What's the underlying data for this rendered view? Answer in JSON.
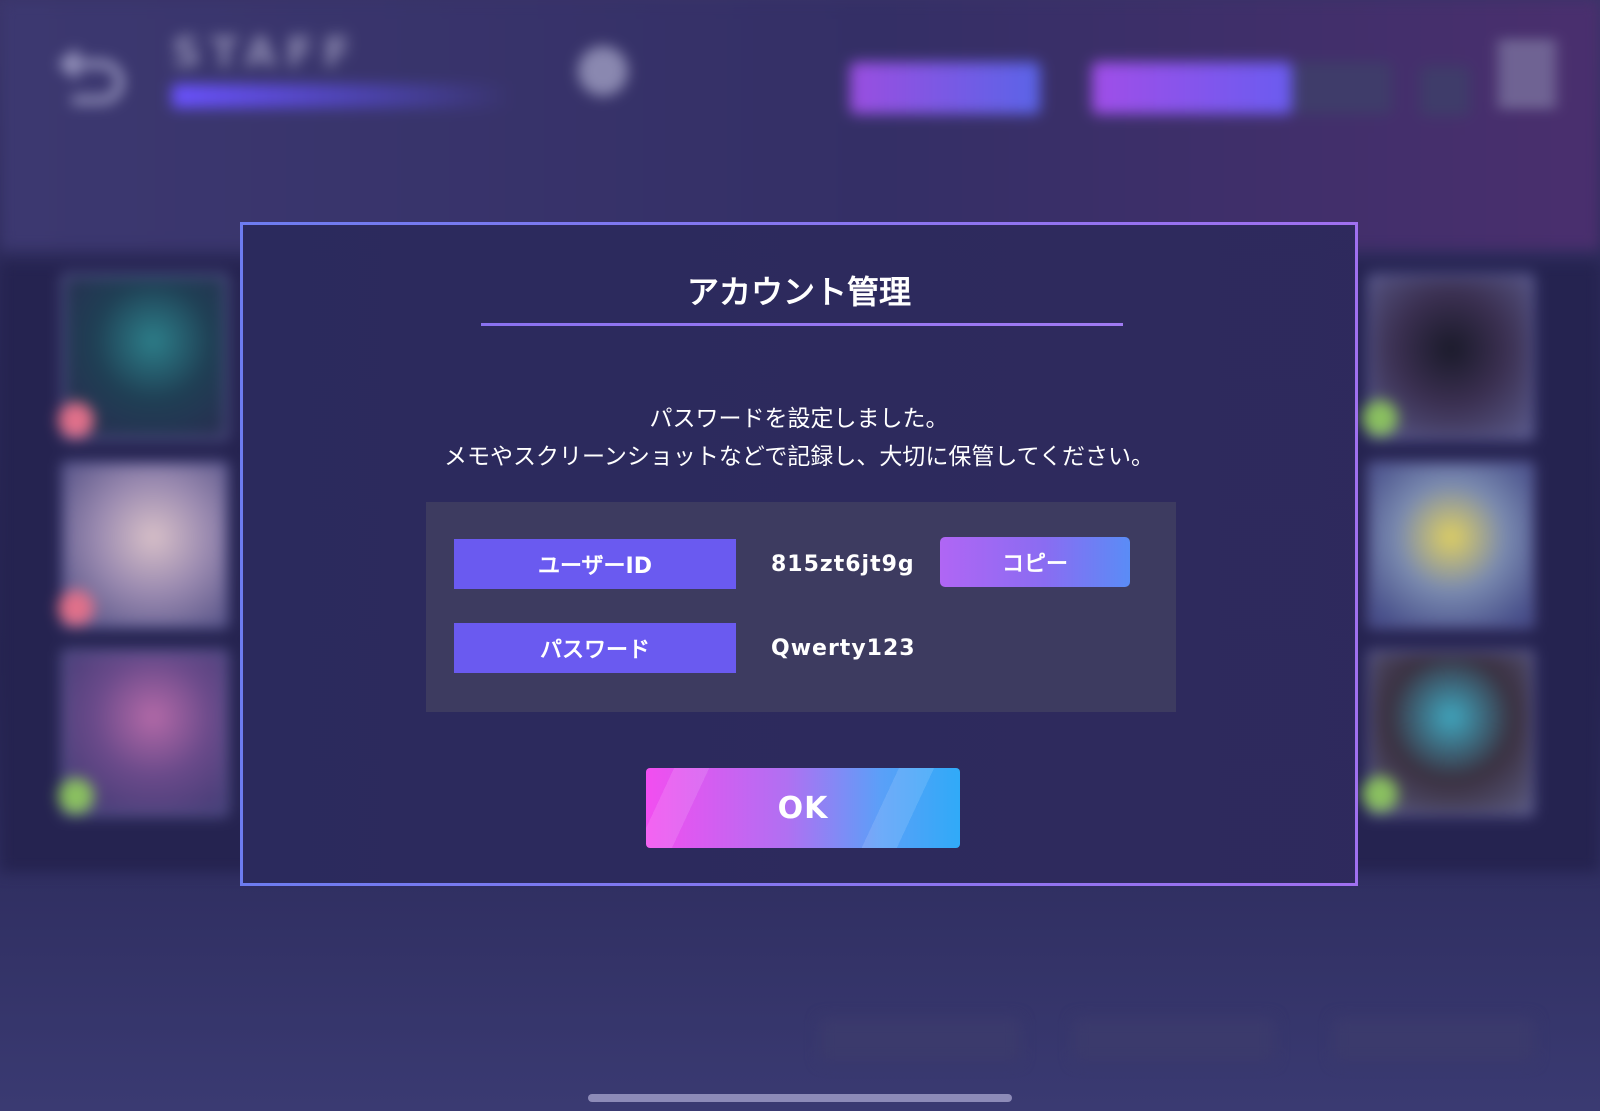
{
  "background": {
    "header": {
      "title": "STAFF"
    }
  },
  "dialog": {
    "title": "アカウント管理",
    "message_line1": "パスワードを設定しました。",
    "message_line2": "メモやスクリーンショットなどで記録し、大切に保管してください。",
    "fields": {
      "user_id": {
        "label": "ユーザーID",
        "value": "815zt6jt9g"
      },
      "password": {
        "label": "パスワード",
        "value": "Qwerty123"
      }
    },
    "copy_label": "コピー",
    "ok_label": "OK"
  },
  "colors": {
    "accent": "#6a5af0",
    "modal_border_start": "#6d7cf0",
    "modal_border_end": "#a070f0",
    "ok_gradient_start": "#f24ef0",
    "ok_gradient_end": "#30aaf8"
  },
  "icons": [
    "back-icon",
    "clock-icon",
    "heart-icon",
    "grid-menu-icon"
  ]
}
